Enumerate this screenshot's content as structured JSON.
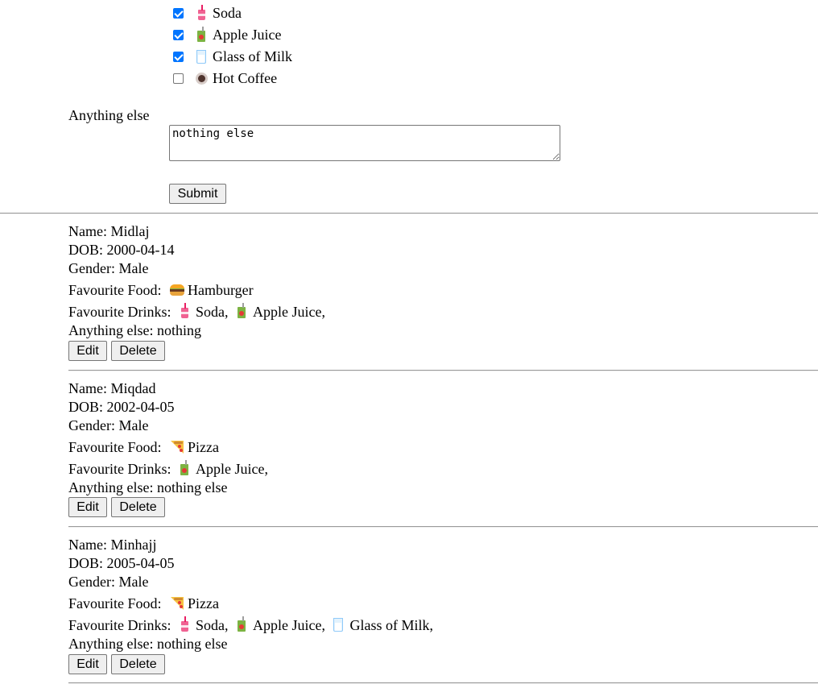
{
  "form": {
    "drinks": [
      {
        "label": "Soda",
        "icon": "soda-cup-icon",
        "checked": true
      },
      {
        "label": "Apple Juice",
        "icon": "juice-box-icon",
        "checked": true
      },
      {
        "label": "Glass of Milk",
        "icon": "glass-of-milk-icon",
        "checked": true
      },
      {
        "label": "Hot Coffee",
        "icon": "hot-coffee-icon",
        "checked": false
      }
    ],
    "anything_else_label": "Anything else",
    "anything_else_value": "nothing else",
    "submit_label": "Submit"
  },
  "entries": [
    {
      "name_line": "Name: Midlaj",
      "dob_line": "DOB: 2000-04-14",
      "gender_line": "Gender: Male",
      "food_label": "Favourite Food:",
      "food": {
        "label": "Hamburger",
        "icon": "hamburger-icon"
      },
      "drinks_label": "Favourite Drinks:",
      "drinks": [
        {
          "label": "Soda,",
          "icon": "soda-cup-icon"
        },
        {
          "label": "Apple Juice,",
          "icon": "juice-box-icon"
        }
      ],
      "anything_line": "Anything else: nothing",
      "edit_label": "Edit",
      "delete_label": "Delete"
    },
    {
      "name_line": "Name: Miqdad",
      "dob_line": "DOB: 2002-04-05",
      "gender_line": "Gender: Male",
      "food_label": "Favourite Food:",
      "food": {
        "label": "Pizza",
        "icon": "pizza-icon"
      },
      "drinks_label": "Favourite Drinks:",
      "drinks": [
        {
          "label": "Apple Juice,",
          "icon": "juice-box-icon"
        }
      ],
      "anything_line": "Anything else: nothing else",
      "edit_label": "Edit",
      "delete_label": "Delete"
    },
    {
      "name_line": "Name: Minhajj",
      "dob_line": "DOB: 2005-04-05",
      "gender_line": "Gender: Male",
      "food_label": "Favourite Food:",
      "food": {
        "label": "Pizza",
        "icon": "pizza-icon"
      },
      "drinks_label": "Favourite Drinks:",
      "drinks": [
        {
          "label": "Soda,",
          "icon": "soda-cup-icon"
        },
        {
          "label": "Apple Juice,",
          "icon": "juice-box-icon"
        },
        {
          "label": "Glass of Milk,",
          "icon": "glass-of-milk-icon"
        }
      ],
      "anything_line": "Anything else: nothing else",
      "edit_label": "Edit",
      "delete_label": "Delete"
    }
  ],
  "colors": {
    "checkbox_accent": "#0075ff",
    "divider": "#9a9a9a",
    "button_bg": "#efefef"
  }
}
